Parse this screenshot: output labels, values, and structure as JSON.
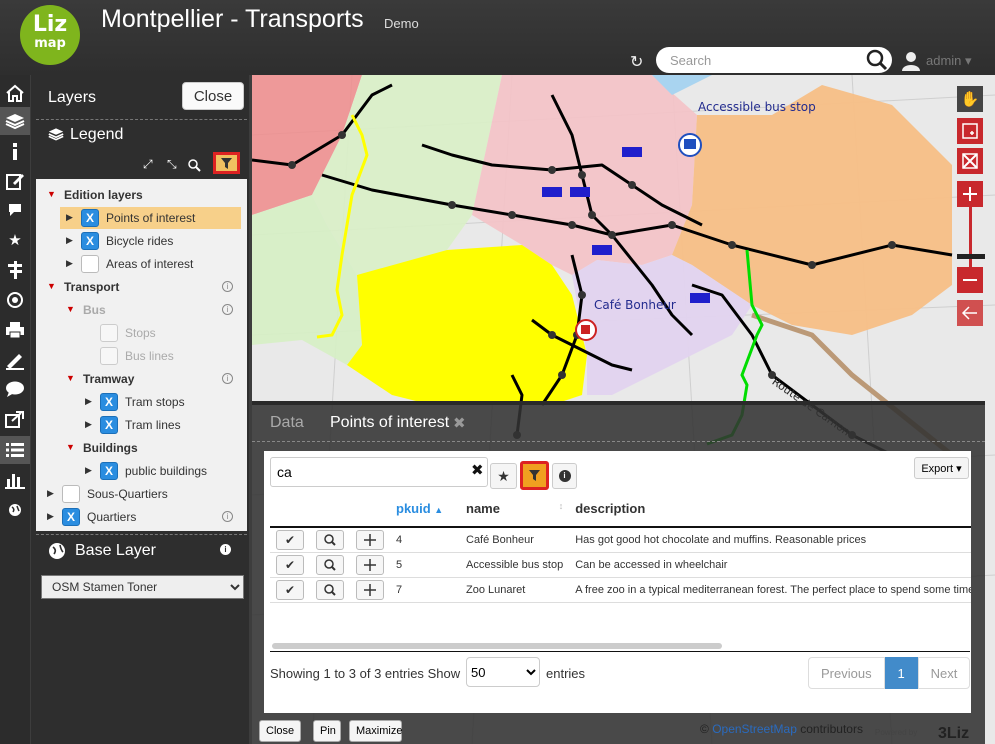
{
  "header": {
    "logo_top": "Liz",
    "logo_bottom": "map",
    "title": "Montpellier - Transports",
    "subtitle": "Demo",
    "search_placeholder": "Search",
    "user": "admin"
  },
  "toolbar_icons": [
    "home-icon",
    "layers-icon",
    "info-icon",
    "edit-icon",
    "comment-icon",
    "star-icon",
    "location-icon",
    "target-icon",
    "print-icon",
    "measure-icon",
    "chat-icon",
    "share-icon",
    "list-icon",
    "chart-icon",
    "globe-icon"
  ],
  "dock": {
    "layers_title": "Layers",
    "close_label": "Close",
    "legend_title": "Legend",
    "baselayer_title": "Base Layer",
    "baselayer_selected": "OSM Stamen Toner",
    "tree": [
      {
        "label": "Edition layers",
        "group": true
      },
      {
        "label": "Points of interest",
        "checked": true,
        "selected": true
      },
      {
        "label": "Bicycle rides",
        "checked": true
      },
      {
        "label": "Areas of interest",
        "checked": false
      },
      {
        "label": "Transport",
        "group": true
      },
      {
        "label": "Bus",
        "group": true,
        "disabled": true
      },
      {
        "label": "Stops",
        "disabled": true
      },
      {
        "label": "Bus lines",
        "disabled": true
      },
      {
        "label": "Tramway",
        "group": true
      },
      {
        "label": "Tram stops",
        "checked": true
      },
      {
        "label": "Tram lines",
        "checked": true
      },
      {
        "label": "Buildings",
        "group": true
      },
      {
        "label": "public buildings",
        "checked": true
      },
      {
        "label": "Sous-Quartiers",
        "checked": false
      },
      {
        "label": "Quartiers",
        "checked": true
      }
    ]
  },
  "map": {
    "labels": {
      "bus_stop": "Accessible bus stop",
      "cafe": "Café Bonheur",
      "road": "Route de Carnon"
    },
    "attribution_prefix": "©",
    "attribution_link": "OpenStreetMap",
    "attribution_suffix": "contributors",
    "powered_by": "Powered by",
    "powered_brand": "3Liz"
  },
  "attribute_table": {
    "tab_data": "Data",
    "tab_layer": "Points of interest",
    "filter_value": "ca",
    "export_label": "Export",
    "columns": [
      "pkuid",
      "name",
      "description"
    ],
    "rows": [
      {
        "pkuid": "4",
        "name": "Café Bonheur",
        "description": "Has got good hot chocolate and muffins. Reasonable prices"
      },
      {
        "pkuid": "5",
        "name": "Accessible bus stop",
        "description": "Can be accessed in wheelchair"
      },
      {
        "pkuid": "7",
        "name": "Zoo Lunaret",
        "description": "A free zoo in a typical mediterranean forest. The perfect place to spend some time"
      }
    ],
    "info": "Showing 1 to 3 of 3 entries",
    "show_label": "Show",
    "page_length": "50",
    "entries_label": "entries",
    "pagination": {
      "previous": "Previous",
      "current": "1",
      "next": "Next"
    }
  },
  "bottom_buttons": {
    "close": "Close",
    "pin": "Pin",
    "maximize": "Maximize"
  },
  "colors": {
    "accent": "#2a8de0",
    "selected_row": "#f7d08a",
    "filter_active": "#f0a020",
    "map_nav": "#c8282d",
    "logo": "#7fb51d"
  }
}
